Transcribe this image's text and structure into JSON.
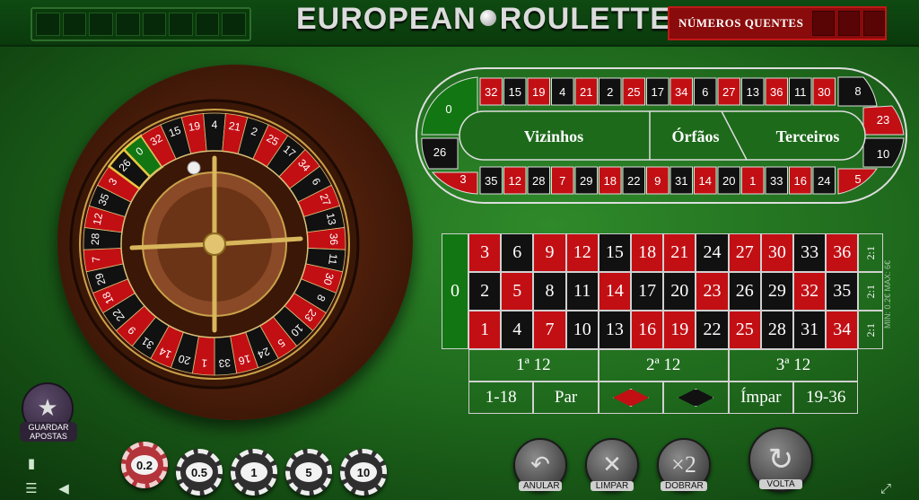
{
  "header": {
    "title_left": "EUROPEAN",
    "title_right": "ROULETTE",
    "hot_numbers_label": "NÚMEROS QUENTES",
    "history_slots": 8,
    "hot_slots": 3
  },
  "wheel": {
    "sequence": [
      0,
      32,
      15,
      19,
      4,
      21,
      2,
      25,
      17,
      34,
      6,
      27,
      13,
      36,
      11,
      30,
      8,
      23,
      10,
      5,
      24,
      16,
      33,
      1,
      20,
      14,
      31,
      9,
      22,
      18,
      29,
      7,
      28,
      12,
      35,
      3,
      26
    ],
    "highlighted_numbers": [
      26,
      0
    ],
    "colors": {
      "red": "#c20f14",
      "black": "#111111",
      "green": "#127712",
      "highlight": "#e8c642"
    }
  },
  "racetrack": {
    "top_row": [
      32,
      15,
      19,
      4,
      21,
      2,
      25,
      17,
      34,
      6,
      27,
      13,
      36,
      11,
      30
    ],
    "bottom_row": [
      35,
      12,
      28,
      7,
      29,
      18,
      22,
      9,
      31,
      14,
      20,
      1,
      33,
      16,
      24
    ],
    "left_cap": [
      "0",
      "26",
      "3"
    ],
    "right_cap": [
      "8",
      "23",
      "10",
      "5"
    ],
    "sections": [
      "Vizinhos",
      "Órfãos",
      "Terceiros"
    ]
  },
  "table": {
    "zero": "0",
    "rows": [
      [
        3,
        6,
        9,
        12,
        15,
        18,
        21,
        24,
        27,
        30,
        33,
        36
      ],
      [
        2,
        5,
        8,
        11,
        14,
        17,
        20,
        23,
        26,
        29,
        32,
        35
      ],
      [
        1,
        4,
        7,
        10,
        13,
        16,
        19,
        22,
        25,
        28,
        31,
        34
      ]
    ],
    "red_numbers": [
      1,
      3,
      5,
      7,
      9,
      12,
      14,
      16,
      18,
      19,
      21,
      23,
      25,
      27,
      30,
      32,
      34,
      36
    ],
    "columns_label": [
      "2:1",
      "2:1",
      "2:1"
    ],
    "dozens": [
      "1ª 12",
      "2ª 12",
      "3ª 12"
    ],
    "even_money": [
      "1-18",
      "Par",
      "",
      "",
      "Ímpar",
      "19-36"
    ],
    "limits": "MIN: 0.2€ MAX: 6€"
  },
  "chips": [
    {
      "value": "0.2",
      "selected": true
    },
    {
      "value": "0.5",
      "selected": false
    },
    {
      "value": "1",
      "selected": false
    },
    {
      "value": "5",
      "selected": false
    },
    {
      "value": "10",
      "selected": false
    }
  ],
  "controls": {
    "undo": "ANULAR",
    "clear": "LIMPAR",
    "double": "DOBRAR",
    "spin": "VOLTA",
    "save_bets": "GUARDAR APOSTAS"
  }
}
